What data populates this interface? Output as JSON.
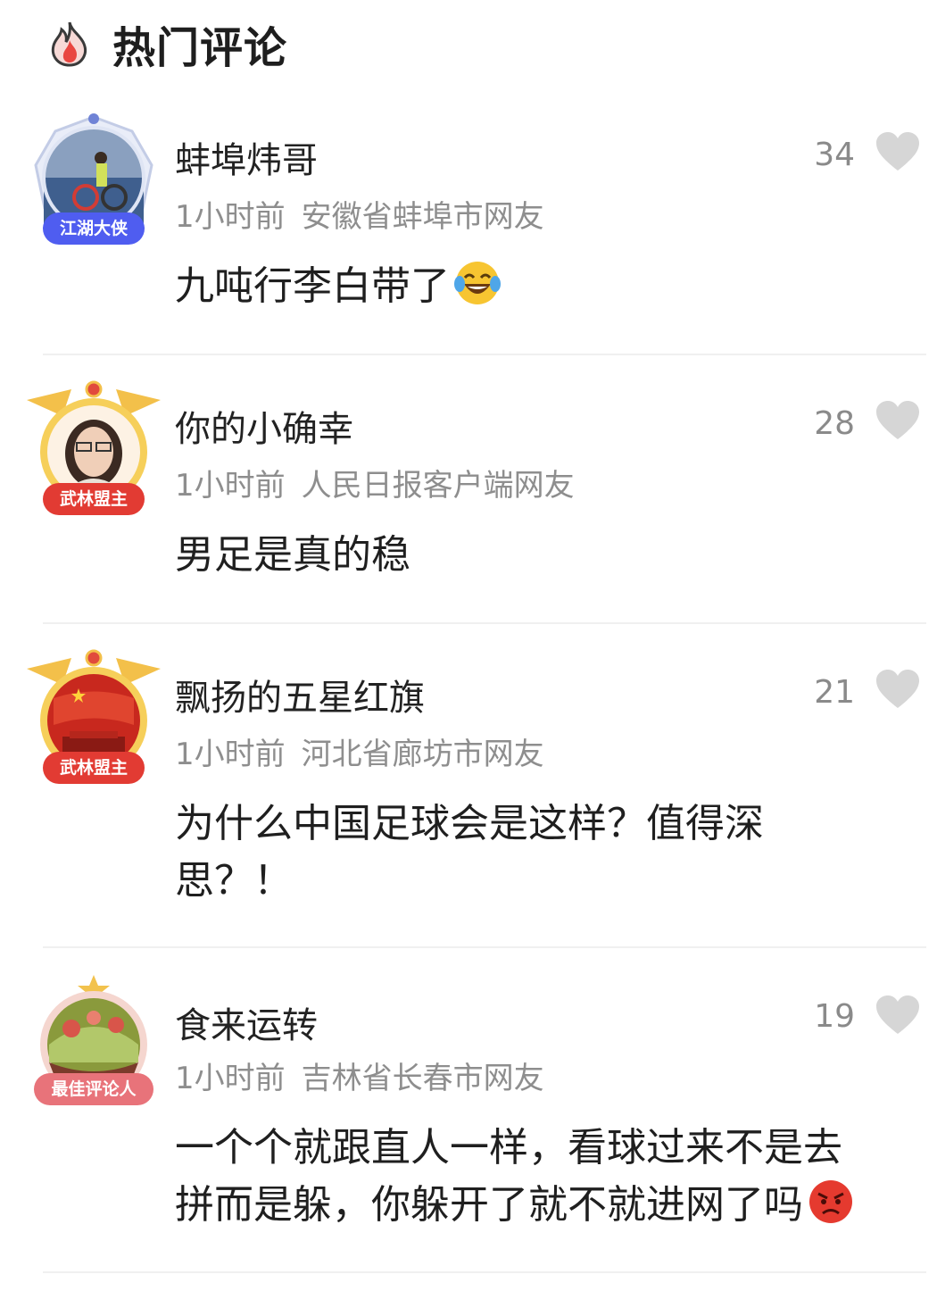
{
  "header": {
    "title": "热门评论",
    "icon": "fire-icon"
  },
  "comments": [
    {
      "username": "蚌埠炜哥",
      "time": "1小时前",
      "location": "安徽省蚌埠市网友",
      "likes": "34",
      "text": "九吨行李白带了",
      "emoji": "tears-of-joy-emoji",
      "badge": "江湖大侠"
    },
    {
      "username": "你的小确幸",
      "time": "1小时前",
      "location": "人民日报客户端网友",
      "likes": "28",
      "text": "男足是真的稳",
      "badge": "武林盟主"
    },
    {
      "username": "飘扬的五星红旗",
      "time": "1小时前",
      "location": "河北省廊坊市网友",
      "likes": "21",
      "text_line1": "为什么中国足球会是这样？值得深",
      "text_line2": "思？！",
      "badge": "武林盟主"
    },
    {
      "username": "食来运转",
      "time": "1小时前",
      "location": "吉林省长春市网友",
      "likes": "19",
      "text_line1": "一个个就跟直人一样，看球过来不是去",
      "text_line2": "拼而是躲，你躲开了就不就进网了吗",
      "emoji": "angry-face-emoji",
      "badge": "最佳评论人"
    }
  ],
  "colors": {
    "badge_blue": "#4f5df0",
    "badge_red": "#e23b33",
    "badge_pink": "#e8737a",
    "gold_frame": "#f3c04a",
    "like_gray": "#d6d6d6"
  }
}
